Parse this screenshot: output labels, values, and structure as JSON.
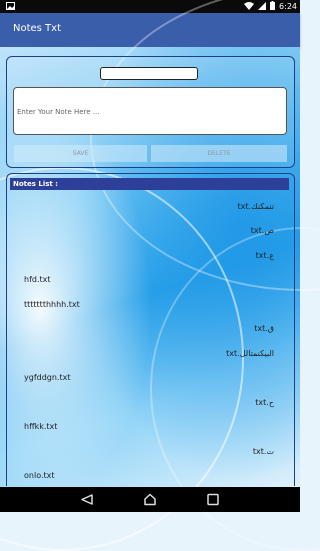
{
  "status_bar": {
    "time": "6:24"
  },
  "app_bar": {
    "title": "Notes Txt"
  },
  "editor": {
    "name_value": "",
    "note_placeholder": "Enter Your Note Here ...",
    "save_label": "SAVE",
    "delete_label": "DELETE"
  },
  "notes_list": {
    "header": "Notes List :",
    "items": [
      {
        "label": "تنمكنك.txt",
        "dir": "rtl"
      },
      {
        "label": "ص.txt",
        "dir": "rtl"
      },
      {
        "label": "ع.txt",
        "dir": "rtl"
      },
      {
        "label": "hfd.txt",
        "dir": "ltr"
      },
      {
        "label": "ttttttthhhh.txt",
        "dir": "ltr"
      },
      {
        "label": "ق.txt",
        "dir": "rtl"
      },
      {
        "label": "البيكنمتالل.txt",
        "dir": "rtl"
      },
      {
        "label": "ygfddgn.txt",
        "dir": "ltr"
      },
      {
        "label": "ح.txt",
        "dir": "rtl"
      },
      {
        "label": "hffkk.txt",
        "dir": "ltr"
      },
      {
        "label": "ت.txt",
        "dir": "rtl"
      },
      {
        "label": "onlo.txt",
        "dir": "ltr"
      }
    ]
  },
  "icons": {
    "status": [
      "photo-icon",
      "wifi-icon",
      "signal-icon",
      "battery-icon"
    ],
    "nav": [
      "back-icon",
      "home-icon",
      "recents-icon"
    ]
  },
  "colors": {
    "app_bar": "#3b5eab",
    "list_header": "#2e3f99",
    "status_bar": "#0a0a0a"
  }
}
